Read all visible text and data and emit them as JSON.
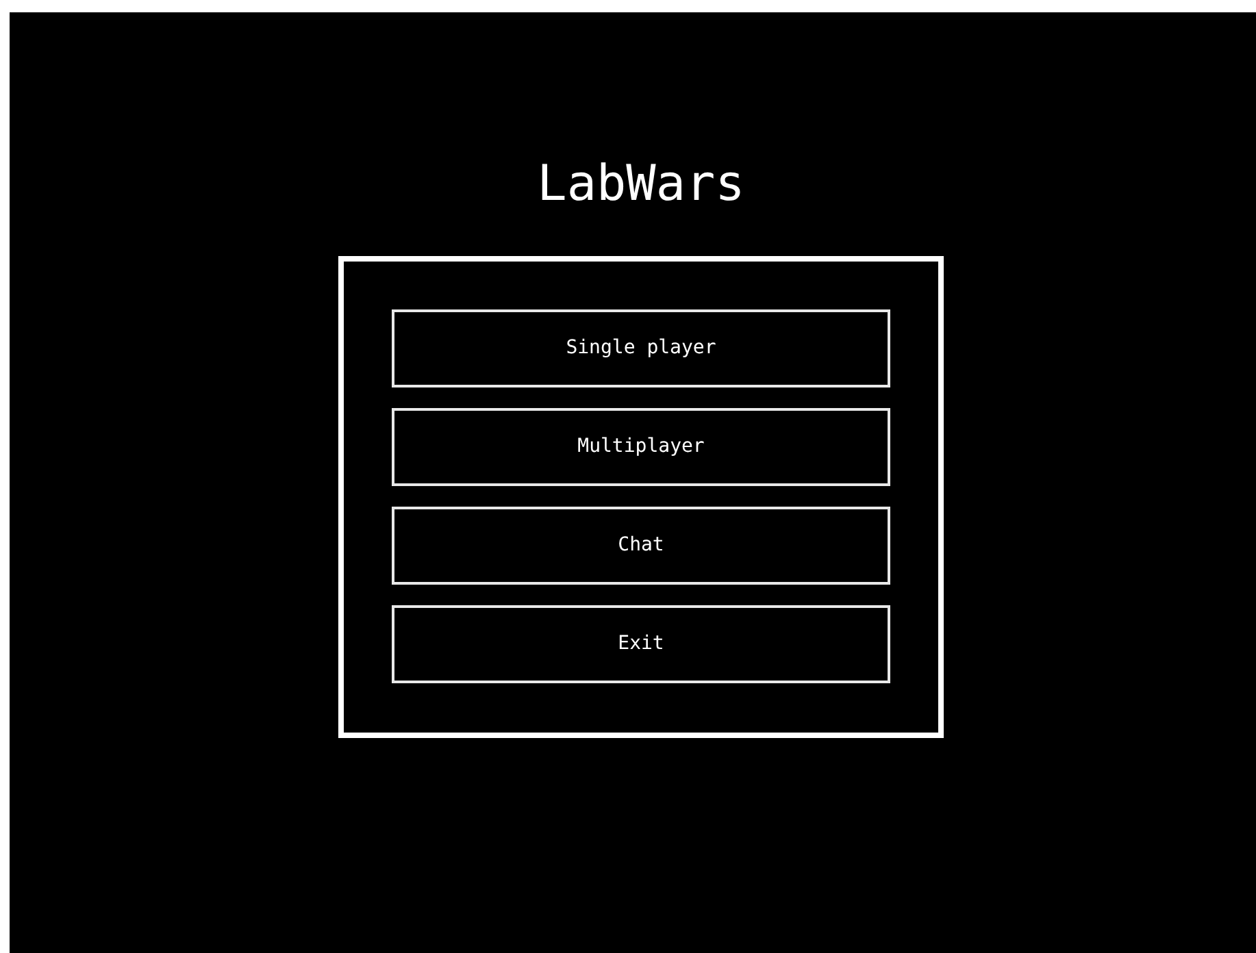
{
  "title": "LabWars",
  "menu": [
    {
      "label": "Single player"
    },
    {
      "label": "Multiplayer"
    },
    {
      "label": "Chat"
    },
    {
      "label": "Exit"
    }
  ]
}
